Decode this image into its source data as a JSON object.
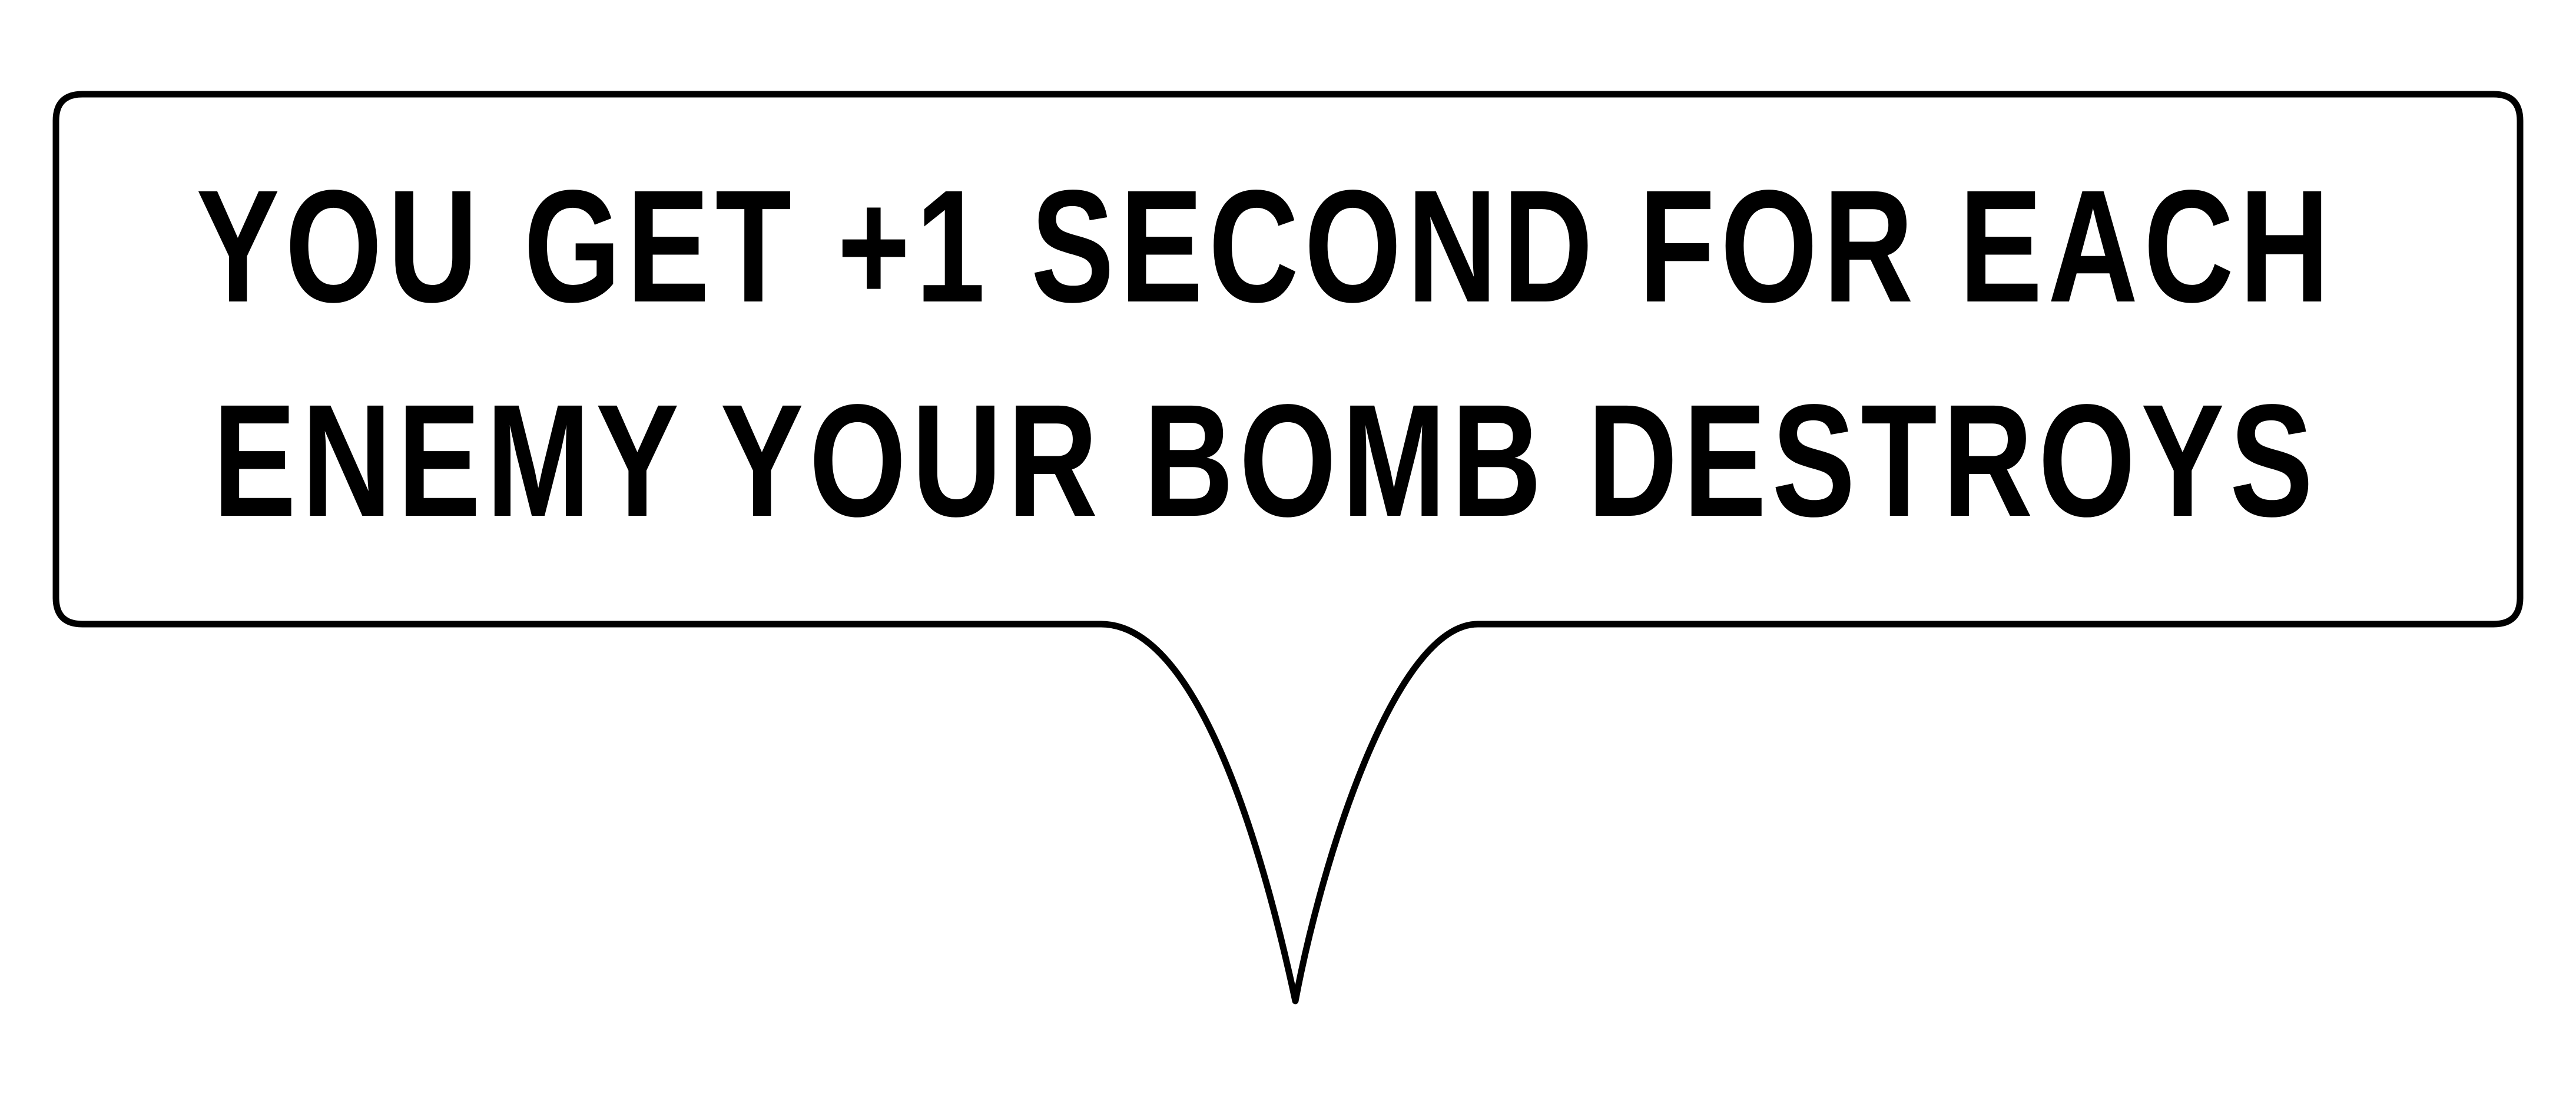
{
  "speech_bubble": {
    "line1": "YOU GET +1 SECOND FOR EACH",
    "line2": "ENEMY YOUR BOMB DESTROYS"
  },
  "colors": {
    "background": "#ffffff",
    "outline": "#000000",
    "text": "#000000"
  }
}
